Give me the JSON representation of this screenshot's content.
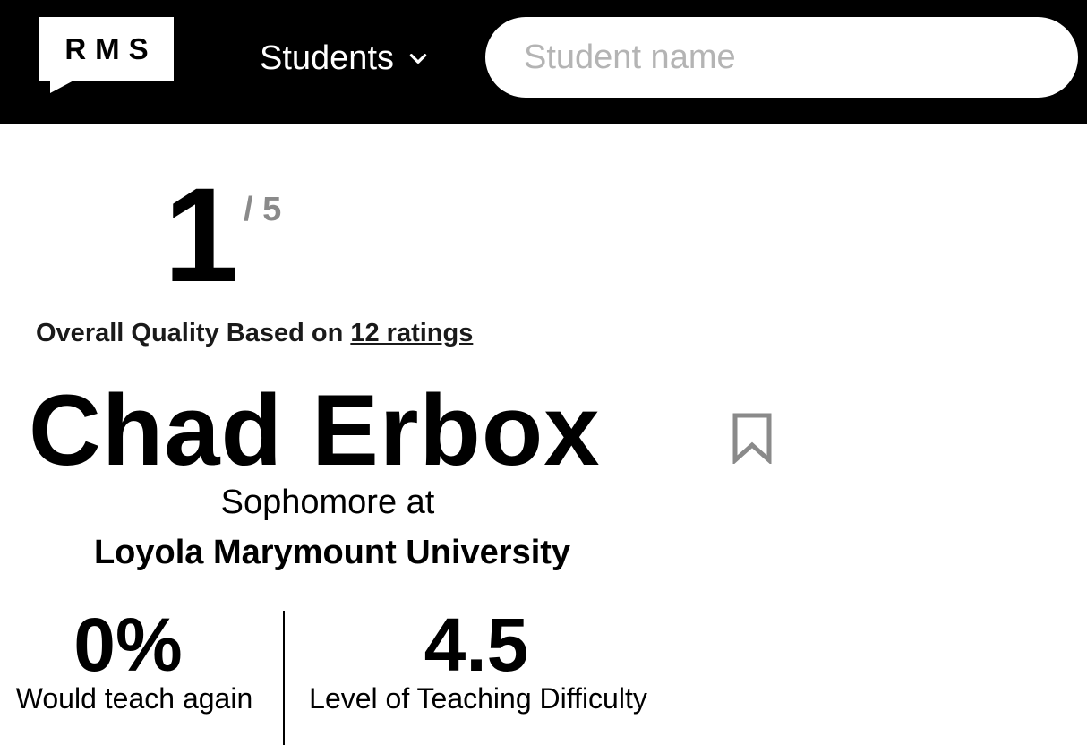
{
  "header": {
    "logo_text": "RMS",
    "nav_dropdown_label": "Students",
    "search_placeholder": "Student name",
    "search_value": ""
  },
  "rating": {
    "score": "1",
    "score_max": "/ 5",
    "quality_prefix": "Overall Quality Based on ",
    "ratings_link": "12 ratings"
  },
  "student": {
    "name": "Chad Erbox",
    "year_line": "Sophomore at",
    "school": "Loyola Marymount University"
  },
  "stats": [
    {
      "value": "0%",
      "label": "Would teach again"
    },
    {
      "value": "4.5",
      "label": "Level of Teaching Difficulty"
    }
  ],
  "icons": {
    "dropdown": "chevron-down-icon",
    "bookmark": "bookmark-icon"
  },
  "colors": {
    "header_bg": "#000000",
    "score_max": "#8a8a8a",
    "bookmark": "#8a8a8a",
    "placeholder": "#b4b4b4"
  }
}
